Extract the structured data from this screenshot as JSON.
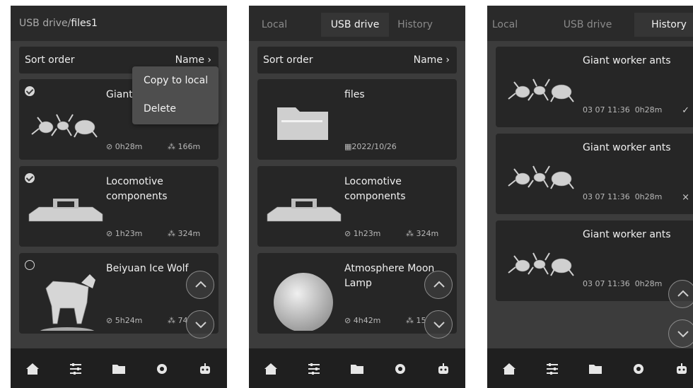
{
  "screen1": {
    "path_prefix": "USB drive/",
    "path_current": "files1",
    "sort_label": "Sort order",
    "sort_value": "Name",
    "menu": {
      "copy": "Copy to local",
      "delete": "Delete"
    },
    "items": [
      {
        "title": "Giant",
        "time": "0h28m",
        "filament": "166m"
      },
      {
        "title": "Locomotive components",
        "time": "1h23m",
        "filament": "324m"
      },
      {
        "title": "Beiyuan Ice Wolf",
        "time": "5h24m",
        "filament": "74"
      }
    ]
  },
  "screen2": {
    "tabs": [
      "Local",
      "USB drive",
      "History"
    ],
    "active_tab": "USB drive",
    "sort_label": "Sort order",
    "sort_value": "Name",
    "items": [
      {
        "title": "files",
        "date": "2022/10/26"
      },
      {
        "title": "Locomotive components",
        "time": "1h23m",
        "filament": "324m"
      },
      {
        "title": "Atmosphere Moon Lamp",
        "time": "4h42m",
        "filament": "15"
      }
    ]
  },
  "screen3": {
    "tabs": [
      "Local",
      "USB drive",
      "History"
    ],
    "active_tab": "History",
    "items": [
      {
        "title": "Giant worker ants",
        "date": "03 07 11:36",
        "time": "0h28m",
        "status": "✓"
      },
      {
        "title": "Giant worker ants",
        "date": "03 07 11:36",
        "time": "0h28m",
        "status": "×"
      },
      {
        "title": "Giant worker ants",
        "date": "03 07 11:36",
        "time": "0h28m",
        "status": ""
      }
    ]
  },
  "icons": {
    "chevron": "›",
    "clock": "⊘",
    "filament": "⁂",
    "calendar": "▦"
  },
  "colors": {
    "background": "#3c3c3c",
    "card": "#262626",
    "bar": "#1f1f1f",
    "text": "#f0f0f0"
  }
}
